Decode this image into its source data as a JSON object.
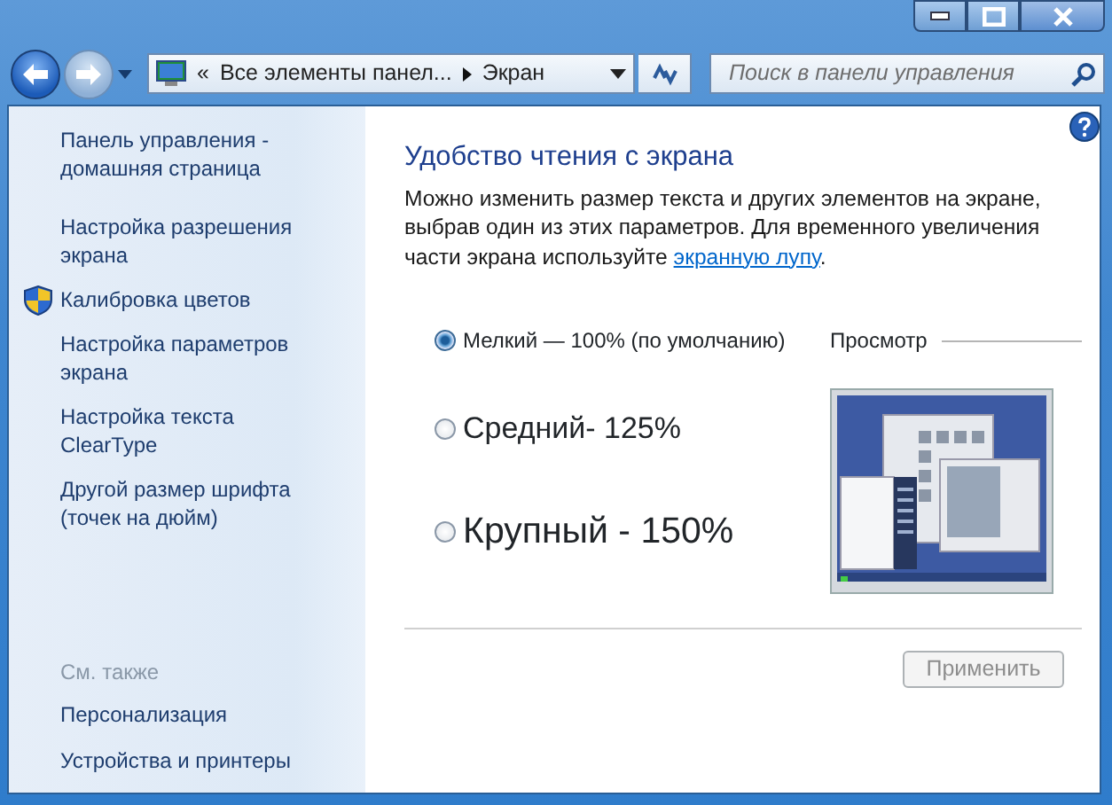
{
  "navigation": {
    "back": {
      "disabled": false
    },
    "forward": {
      "disabled": true
    }
  },
  "address_bar": {
    "overflow": "«",
    "crumbs": [
      "Все элементы панел...",
      "Экран"
    ]
  },
  "search": {
    "placeholder": "Поиск в панели управления"
  },
  "sidebar": {
    "items": [
      {
        "label": "Панель управления - домашняя страница",
        "kind": "link"
      },
      {
        "label": "Настройка разрешения экрана",
        "kind": "link"
      },
      {
        "label": "Калибровка цветов",
        "kind": "shield"
      },
      {
        "label": "Настройка параметров экрана",
        "kind": "link"
      },
      {
        "label": "Настройка текста ClearType",
        "kind": "link"
      },
      {
        "label": "Другой размер шрифта (точек на дюйм)",
        "kind": "link"
      }
    ],
    "see_also": {
      "heading": "См. также",
      "items": [
        "Персонализация",
        "Устройства и принтеры"
      ]
    }
  },
  "main": {
    "title": "Удобство чтения с экрана",
    "description": "Можно изменить размер текста и других элементов на экране, выбрав один из этих параметров. Для временного увеличения части экрана используйте ",
    "link": "экранную лупу",
    "description_end": ".",
    "options": [
      {
        "label": "Мелкий — 100% (по умолчанию)",
        "selected": true
      },
      {
        "label": "Средний- 125%",
        "selected": false
      },
      {
        "label": "Крупный - 150%",
        "selected": false
      }
    ],
    "preview_label": "Просмотр",
    "apply_button": {
      "label": "Применить",
      "disabled": true
    }
  }
}
